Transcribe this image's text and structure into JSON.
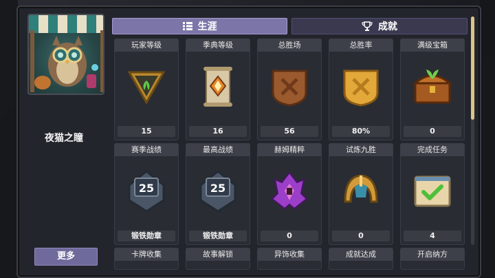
{
  "profile": {
    "name": "夜猫之瞳",
    "more_label": "更多"
  },
  "tabs": {
    "career": "生涯",
    "achievement": "成就"
  },
  "stats_row1": [
    {
      "title": "玩家等级",
      "value": "15",
      "icon": "green-triangle-badge-icon"
    },
    {
      "title": "季典等级",
      "value": "16",
      "icon": "scroll-star-icon"
    },
    {
      "title": "总胜场",
      "value": "56",
      "icon": "bronze-shield-icon"
    },
    {
      "title": "总胜率",
      "value": "80%",
      "icon": "gold-shield-icon"
    },
    {
      "title": "满级宝箱",
      "value": "0",
      "icon": "treasure-chest-icon"
    }
  ],
  "stats_row2": [
    {
      "title": "赛季战绩",
      "value": "锻铁勋章",
      "badge": "25",
      "icon": "iron-medal-icon"
    },
    {
      "title": "最高战绩",
      "value": "锻铁勋章",
      "badge": "25",
      "icon": "iron-medal-icon"
    },
    {
      "title": "赫姆精粹",
      "value": "0",
      "icon": "purple-crystal-icon"
    },
    {
      "title": "试炼九胜",
      "value": "0",
      "icon": "golden-helmet-icon"
    },
    {
      "title": "完成任务",
      "value": "4",
      "icon": "checkmark-scroll-icon"
    }
  ],
  "stats_row3": [
    {
      "title": "卡牌收集"
    },
    {
      "title": "故事解锁"
    },
    {
      "title": "异饰收集"
    },
    {
      "title": "成就达成"
    },
    {
      "title": "开启纳方"
    }
  ],
  "colors": {
    "accent": "#7c75a8",
    "gold": "#e2a93a",
    "panel": "#23252c"
  }
}
